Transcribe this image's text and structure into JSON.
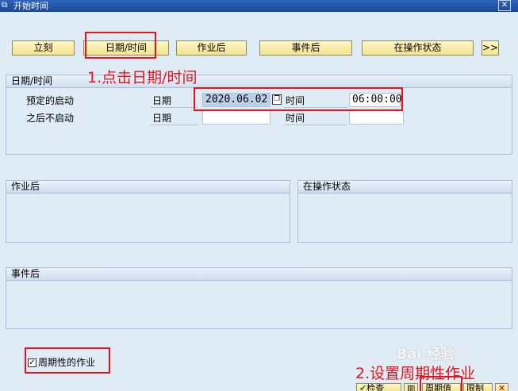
{
  "window": {
    "title": "开始时间",
    "close_glyph": "✕",
    "icon_glyph": "⧉"
  },
  "toolbar": {
    "immediate": "立刻",
    "date_time": "日期/时间",
    "after_job": "作业后",
    "after_event": "事件后",
    "at_operation_mode": "在操作状态",
    "more": ">>"
  },
  "date_time_group": {
    "header": "日期/时间",
    "scheduled_start_label": "预定的启动",
    "no_start_after_label": "之后不启动",
    "date_label": "日期",
    "time_label": "时间",
    "scheduled_date": "2020.06.02",
    "scheduled_time": "06:00:00",
    "no_start_date": "",
    "no_start_time": ""
  },
  "after_job_group": {
    "header": "作业后"
  },
  "operation_mode_group": {
    "header": "在操作状态"
  },
  "after_event_group": {
    "header": "事件后"
  },
  "periodic_job": {
    "label": "周期性的作业",
    "checked_glyph": "✓"
  },
  "annotations": {
    "step1": "1.点击日期/时间",
    "step2": "2.设置周期性作业",
    "color": "#e5141a"
  },
  "bottom_buttons": {
    "check": "检查",
    "period": "周期值",
    "restrict": "限制",
    "cancel_glyph": "✕"
  },
  "watermark": "Bai 经验"
}
